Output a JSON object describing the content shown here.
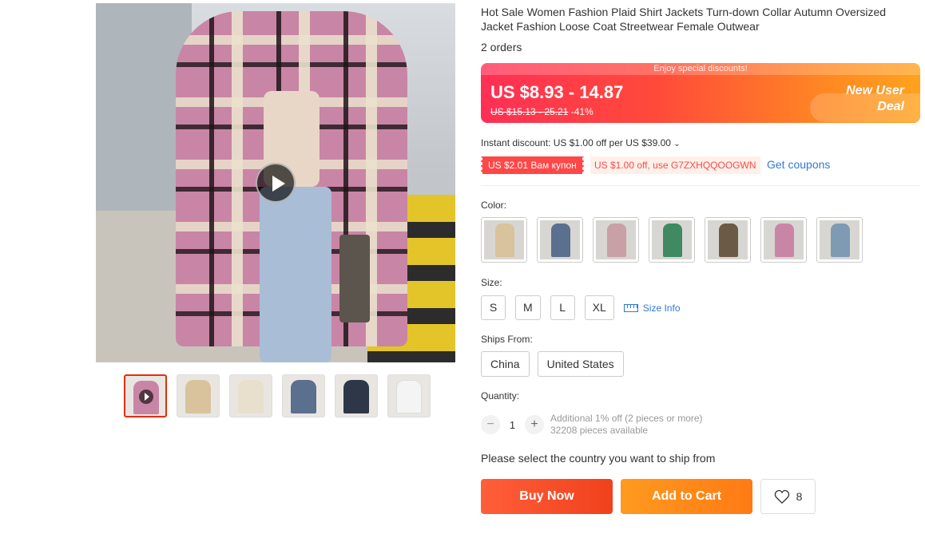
{
  "product": {
    "title": "Hot Sale Women Fashion Plaid Shirt Jackets Turn-down Collar Autumn Oversized Jacket Fashion Loose Coat Streetwear Female Outwear",
    "orders": "2 orders"
  },
  "gallery": {
    "thumb_count": 6,
    "thumb_colors": [
      "#c985a6",
      "#d9c39c",
      "#e8dfcc",
      "#5b6f8e",
      "#2d3748",
      "#f4f4f4"
    ]
  },
  "price": {
    "banner": "Enjoy special discounts!",
    "current": "US $8.93 - 14.87",
    "original": "US $15.13 - 25.21",
    "discount": "-41%",
    "deal_line1": "New User",
    "deal_line2": "Deal"
  },
  "discounts": {
    "instant": "Instant discount: US $1.00 off per US $39.00",
    "coupon": "US $2.01 Вам купон",
    "code": "US $1.00 off, use G7ZXHQQOOGWN",
    "get_coupons": "Get coupons"
  },
  "options": {
    "color_label": "Color:",
    "colors": [
      "#d9c39c",
      "#5b6f8e",
      "#c9a0a5",
      "#3f8a63",
      "#6b5a44",
      "#c985a6",
      "#7f9bb3"
    ],
    "size_label": "Size:",
    "sizes": [
      "S",
      "M",
      "L",
      "XL"
    ],
    "size_info": "Size Info",
    "ships_label": "Ships From:",
    "ships": [
      "China",
      "United States"
    ]
  },
  "quantity": {
    "label": "Quantity:",
    "minus": "−",
    "value": "1",
    "plus": "+",
    "note1": "Additional 1% off (2 pieces or more)",
    "note2": "32208 pieces available"
  },
  "ship_note": "Please select the country you want to ship from",
  "actions": {
    "buy_now": "Buy Now",
    "add_to_cart": "Add to Cart",
    "wishlist_count": "8"
  }
}
